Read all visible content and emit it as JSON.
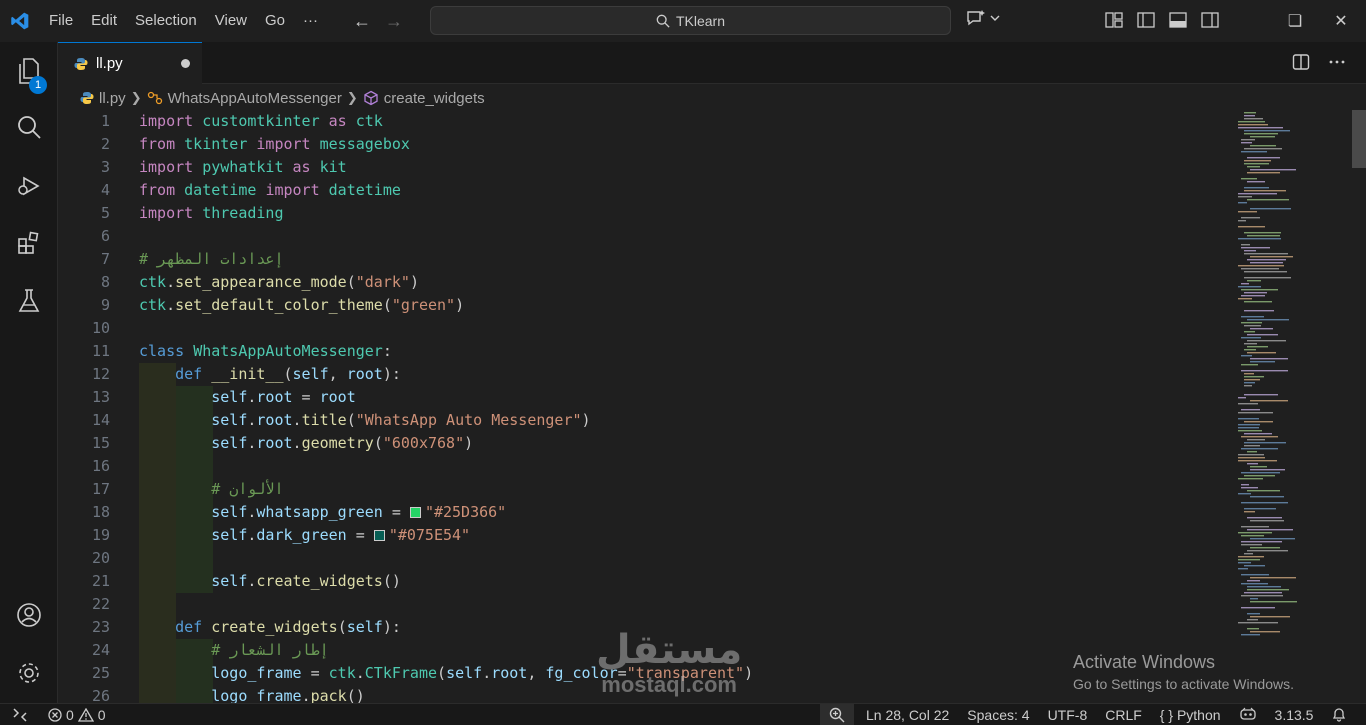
{
  "menu": [
    "File",
    "Edit",
    "Selection",
    "View",
    "Go",
    "···"
  ],
  "search": {
    "text": "TKlearn"
  },
  "activity": {
    "badge": "1"
  },
  "tab": {
    "filename": "ll.py"
  },
  "breadcrumb": {
    "file": "ll.py",
    "cls": "WhatsAppAutoMessenger",
    "method": "create_widgets"
  },
  "editor": {
    "lines": [
      {
        "n": "1",
        "t": "import customtkinter as ctk"
      },
      {
        "n": "2",
        "t": "from tkinter import messagebox"
      },
      {
        "n": "3",
        "t": "import pywhatkit as kit"
      },
      {
        "n": "4",
        "t": "from datetime import datetime"
      },
      {
        "n": "5",
        "t": "import threading"
      },
      {
        "n": "6",
        "t": ""
      },
      {
        "n": "7",
        "t": "# إعدادات المظهر"
      },
      {
        "n": "8",
        "t": "ctk.set_appearance_mode(\"dark\")"
      },
      {
        "n": "9",
        "t": "ctk.set_default_color_theme(\"green\")"
      },
      {
        "n": "10",
        "t": ""
      },
      {
        "n": "11",
        "t": "class WhatsAppAutoMessenger:"
      },
      {
        "n": "12",
        "t": "    def __init__(self, root):"
      },
      {
        "n": "13",
        "t": "        self.root = root"
      },
      {
        "n": "14",
        "t": "        self.root.title(\"WhatsApp Auto Messenger\")"
      },
      {
        "n": "15",
        "t": "        self.root.geometry(\"600x768\")"
      },
      {
        "n": "16",
        "t": ""
      },
      {
        "n": "17",
        "t": "        # الألوان"
      },
      {
        "n": "18",
        "t": "        self.whatsapp_green = \"#25D366\""
      },
      {
        "n": "19",
        "t": "        self.dark_green = \"#075E54\""
      },
      {
        "n": "20",
        "t": ""
      },
      {
        "n": "21",
        "t": "        self.create_widgets()"
      },
      {
        "n": "22",
        "t": ""
      },
      {
        "n": "23",
        "t": "    def create_widgets(self):"
      },
      {
        "n": "24",
        "t": "        # إطار الشعار"
      },
      {
        "n": "25",
        "t": "        logo_frame = ctk.CTkFrame(self.root, fg_color=\"transparent\")"
      },
      {
        "n": "26",
        "t": "        logo_frame.pack()"
      }
    ]
  },
  "colors": {
    "swatch_1": "#25D366",
    "swatch_2": "#075E54",
    "accent": "#0078d4"
  },
  "watermark": {
    "activate_title": "Activate Windows",
    "activate_sub": "Go to Settings to activate Windows.",
    "mostaql_ar": "مستقل",
    "mostaql_en": "mostaql.com"
  },
  "status": {
    "errors": "0",
    "warnings": "0",
    "position": "Ln 28, Col 22",
    "spaces": "Spaces: 4",
    "encoding": "UTF-8",
    "eol": "CRLF",
    "language": "Python",
    "version": "3.13.5"
  }
}
